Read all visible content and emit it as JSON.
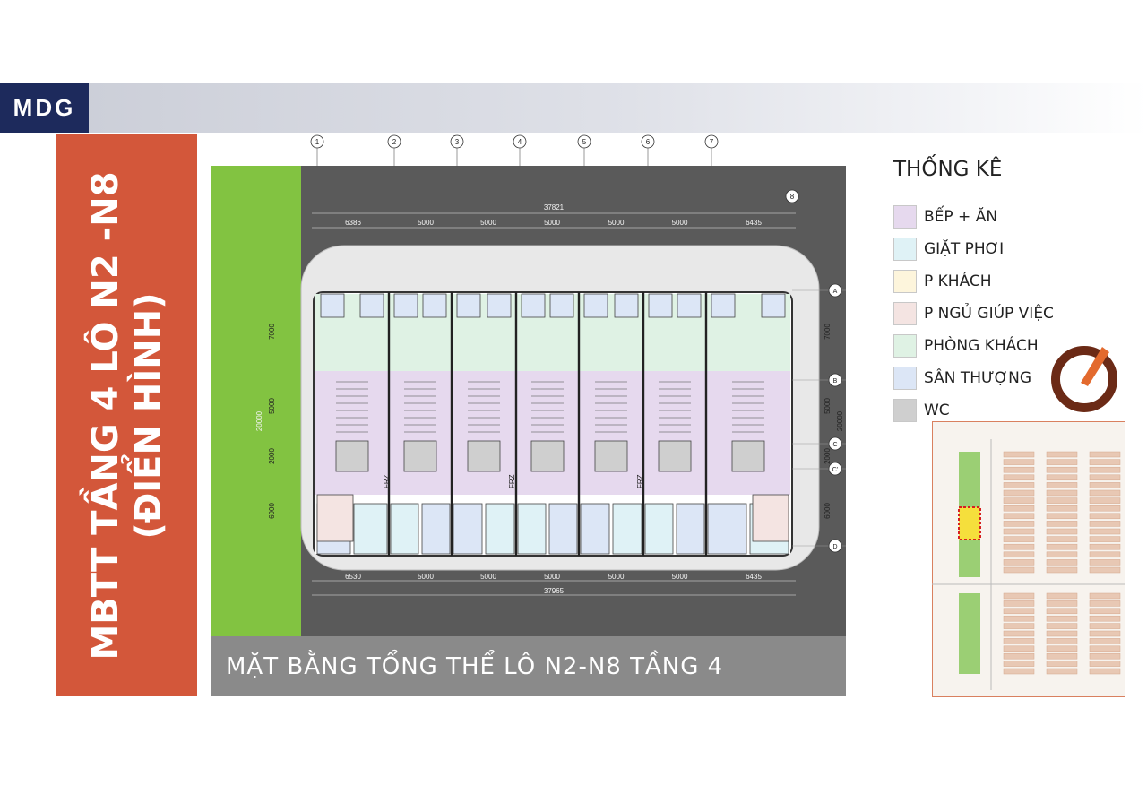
{
  "header": {
    "logo": "MDG"
  },
  "side_title": {
    "line1": "MBTT TẦNG 4 LÔ N2 -N8",
    "line2": "(ĐIỂN HÌNH)"
  },
  "caption": "MẶT BẰNG TỔNG THỂ LÔ N2-N8 TẦNG 4",
  "plan": {
    "grid_numbers": [
      "1",
      "2",
      "3",
      "4",
      "5",
      "6",
      "7"
    ],
    "grid_extra": "8",
    "grid_letters": [
      "A",
      "B",
      "C",
      "C'",
      "D"
    ],
    "top_total": "37821",
    "top_dims": [
      "6386",
      "5000",
      "5000",
      "5000",
      "5000",
      "5000",
      "6435"
    ],
    "bottom_dims": [
      "6530",
      "5000",
      "5000",
      "5000",
      "5000",
      "5000",
      "6435"
    ],
    "bottom_total": "37965",
    "left_total": "20000",
    "left_dims": [
      "7000",
      "5000",
      "2000",
      "6000"
    ],
    "right_dims": [
      "7000",
      "5000",
      "2000",
      "6000"
    ],
    "right_total": "20000",
    "stair_label": "FRZ"
  },
  "legend": {
    "title": "THỐNG KÊ",
    "items": [
      {
        "label": "BẾP + ĂN",
        "color": "#e6d9ee"
      },
      {
        "label": "GIẶT PHƠI",
        "color": "#dff2f6"
      },
      {
        "label": "P KHÁCH",
        "color": "#fdf5dc"
      },
      {
        "label": "P NGỦ GIÚP VIỆC",
        "color": "#f4e4e2"
      },
      {
        "label": "PHÒNG KHÁCH",
        "color": "#dff2e4"
      },
      {
        "label": "SÂN THƯỢNG",
        "color": "#dce6f6"
      },
      {
        "label": "WC",
        "color": "#cfcfcf"
      }
    ]
  },
  "colors": {
    "brand_navy": "#1d2a5c",
    "title_orange": "#d3573a",
    "lawn_green": "#82c341",
    "road_gray": "#5a5a5a",
    "caption_gray": "#8a8a8a"
  }
}
